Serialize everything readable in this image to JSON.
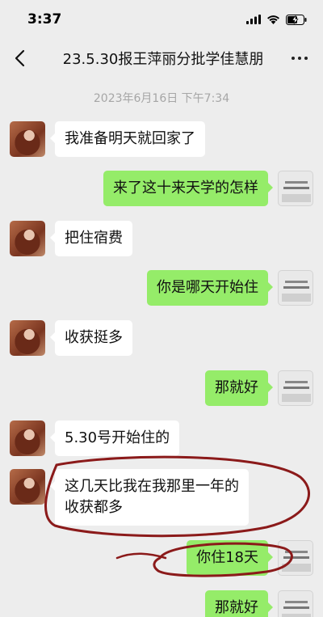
{
  "status_bar": {
    "time": "3:37"
  },
  "chat": {
    "title": "23.5.30报王萍丽分批学佳慧朋",
    "timestamp": "2023年6月16日 下午7:34"
  },
  "messages": [
    {
      "side": "in",
      "text": "我准备明天就回家了"
    },
    {
      "side": "out",
      "text": "来了这十来天学的怎样"
    },
    {
      "side": "in",
      "text": "把住宿费"
    },
    {
      "side": "out",
      "text": "你是哪天开始住"
    },
    {
      "side": "in",
      "text": "收获挺多"
    },
    {
      "side": "out",
      "text": "那就好"
    },
    {
      "side": "in",
      "text": "5.30号开始住的"
    },
    {
      "side": "in",
      "text_line1": "这几天比我在我那里一年的",
      "text_line2": "收获都多"
    },
    {
      "side": "out",
      "text": "你住18天"
    },
    {
      "side": "out",
      "text": "那就好"
    }
  ],
  "colors": {
    "background": "#ededed",
    "bubble_out": "#95ec69",
    "bubble_in": "#ffffff",
    "annotation": "#8b1a1a"
  },
  "icons": [
    "back-icon",
    "more-icon",
    "signal-icon",
    "wifi-icon",
    "battery-charging-icon"
  ]
}
